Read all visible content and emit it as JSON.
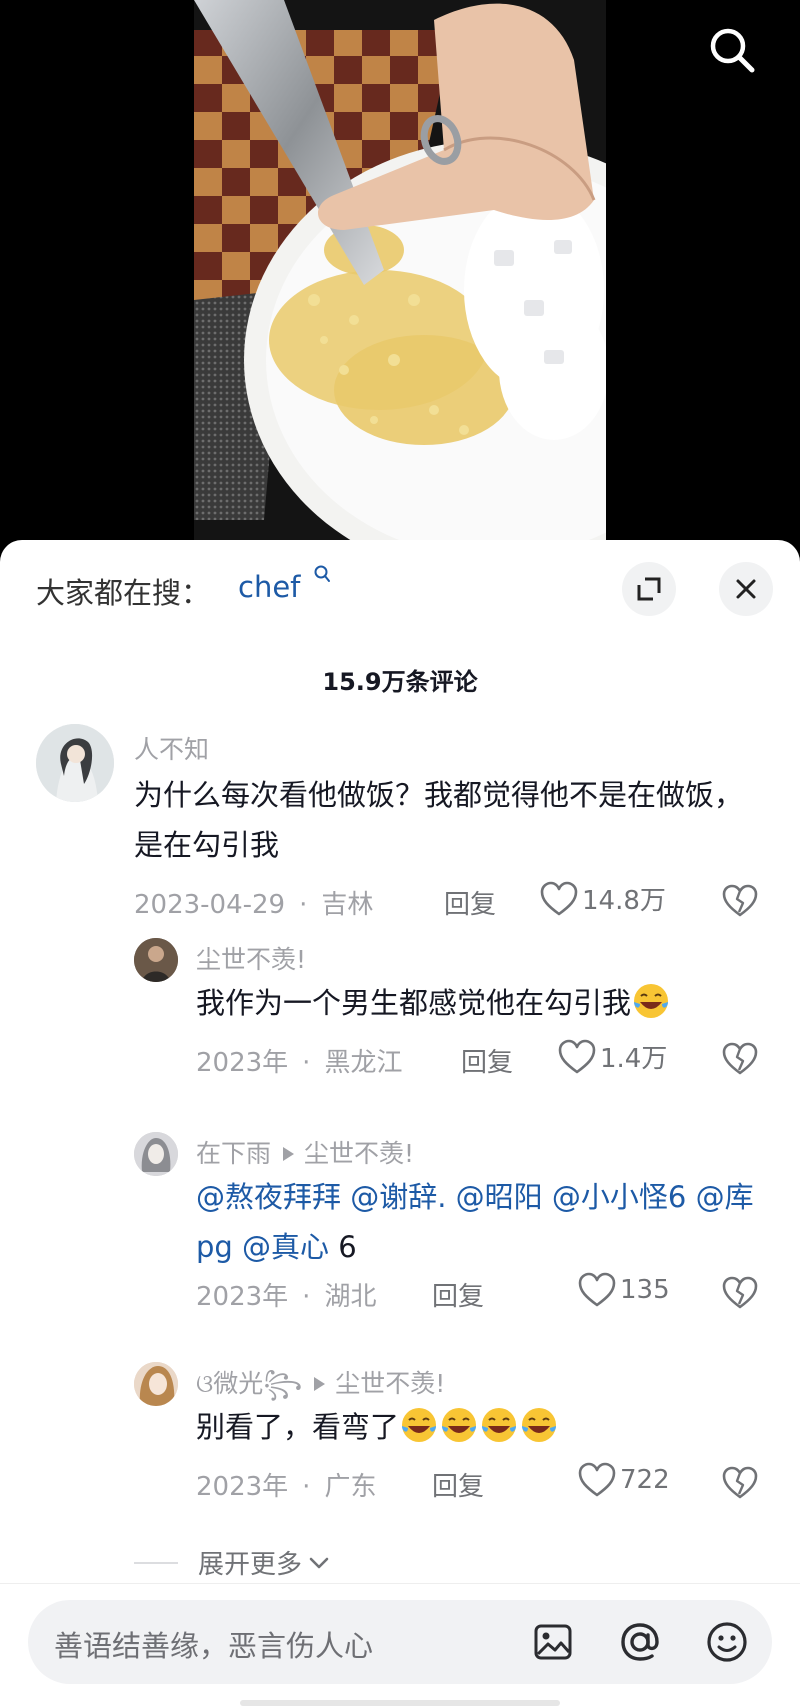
{
  "search": {
    "trending_label": "大家都在搜：",
    "trending_term": "chef"
  },
  "comments_header": {
    "count_label": "15.9万条评论"
  },
  "comments": [
    {
      "author": "人不知",
      "text": "为什么每次看他做饭？我都觉得他不是在做饭，是在勾引我",
      "date": "2023-04-29",
      "location": "吉林",
      "reply_label": "回复",
      "likes": "14.8万"
    }
  ],
  "replies": [
    {
      "author": "尘世不羡!",
      "text": "我作为一个男生都感觉他在勾引我",
      "date": "2023年",
      "location": "黑龙江",
      "reply_label": "回复",
      "likes": "1.4万"
    },
    {
      "author": "在下雨",
      "reply_to": "尘世不羡!",
      "mentions": [
        "@熬夜拜拜",
        "@谢辞.",
        "@昭阳",
        "@小小怪6",
        "@库pg",
        "@真心"
      ],
      "text_suffix": "6",
      "date": "2023年",
      "location": "湖北",
      "reply_label": "回复",
      "likes": "135"
    },
    {
      "author": "ଓ微光꧂",
      "reply_to": "尘世不羡!",
      "text": "别看了，看弯了",
      "date": "2023年",
      "location": "广东",
      "reply_label": "回复",
      "likes": "722"
    }
  ],
  "expand_more": {
    "label": "展开更多"
  },
  "input": {
    "placeholder": "善语结善缘，恶言伤人心"
  },
  "icons": {
    "search": "search-icon",
    "expand": "expand-icon",
    "close": "close-icon",
    "like": "heart-icon",
    "dislike": "broken-heart-icon",
    "emoji": "rofl-emoji",
    "image": "image-icon",
    "mention": "at-icon",
    "emoji_picker": "smiley-icon"
  },
  "colors": {
    "link": "#1d5aa6",
    "muted": "#a0a1a6",
    "text": "#161823"
  }
}
